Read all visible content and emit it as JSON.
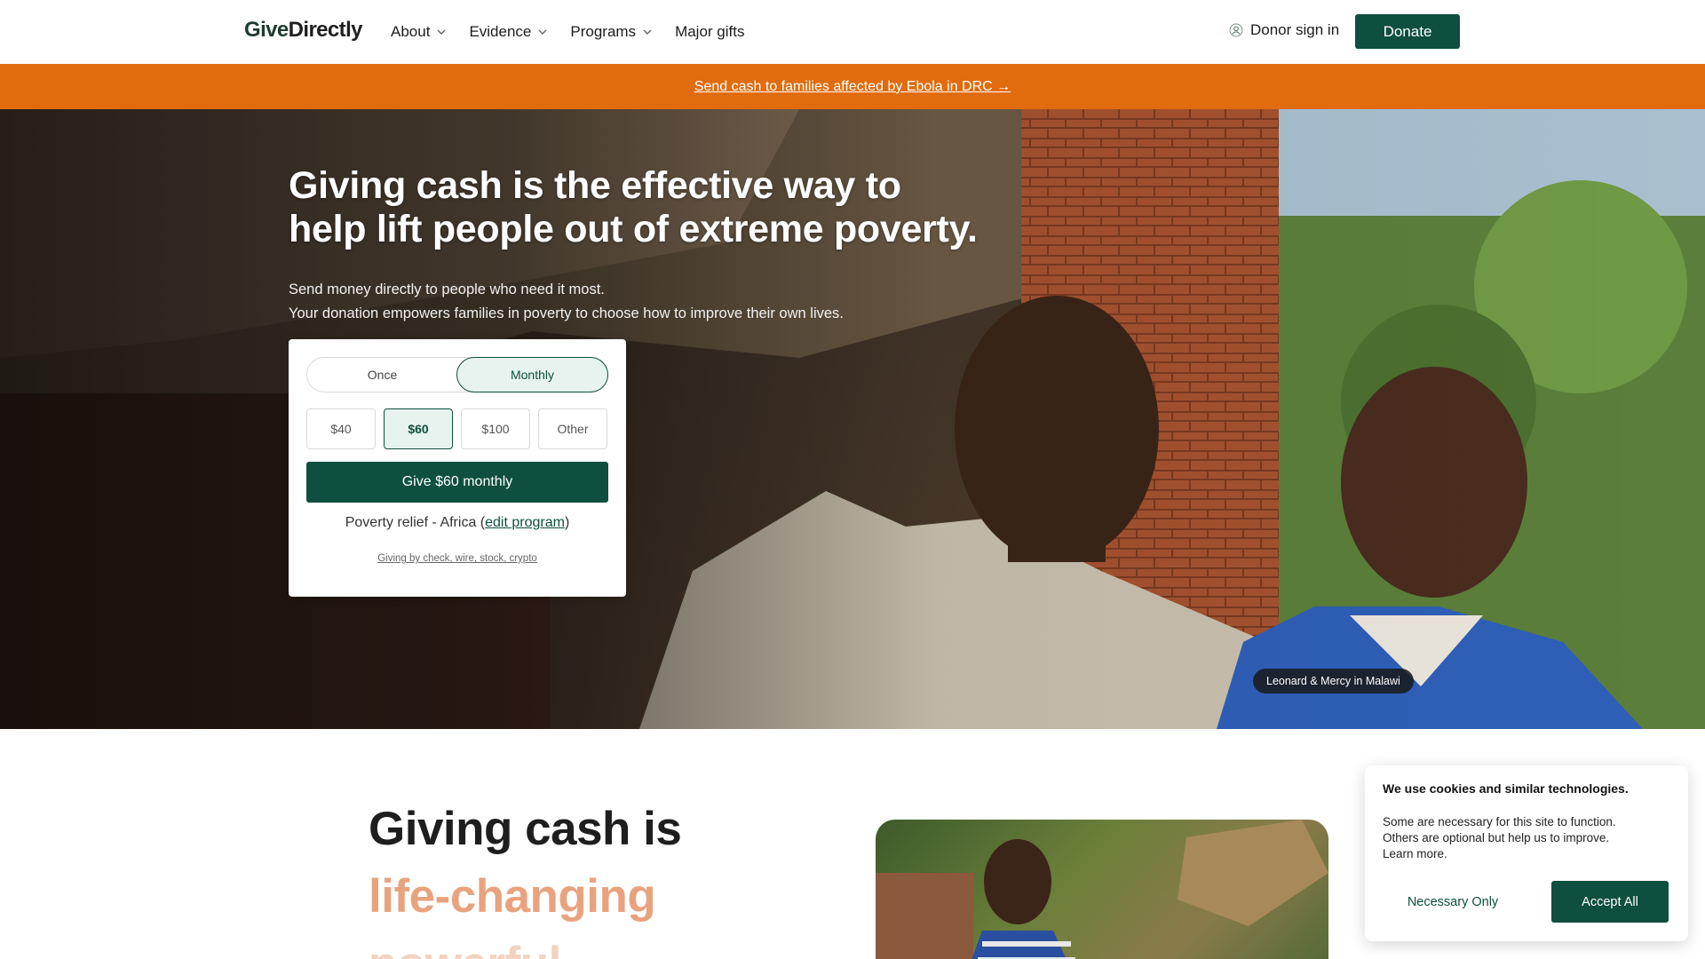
{
  "header": {
    "logo_part1": "Give",
    "logo_part2": "Directly",
    "nav": [
      {
        "label": "About",
        "has_dropdown": true,
        "icon": "chevron-down-icon"
      },
      {
        "label": "Evidence",
        "has_dropdown": true,
        "icon": "chevron-down-icon"
      },
      {
        "label": "Programs",
        "has_dropdown": true,
        "icon": "chevron-down-icon"
      },
      {
        "label": "Major gifts",
        "has_dropdown": false
      }
    ],
    "donor_sign_in": "Donor sign in",
    "donor_icon": "user-icon",
    "donate_label": "Donate"
  },
  "banner": {
    "text": "Send cash to families affected by Ebola in DRC →",
    "color": "#e06c0d"
  },
  "hero": {
    "title": "Giving cash is the effective way to help lift people out of extreme poverty.",
    "subtitle_line1": "Send money directly to people who need it most.",
    "subtitle_line2": "Your donation empowers families in poverty to choose how to improve their own lives.",
    "caption": "Leonard & Mercy in Malawi"
  },
  "donation_card": {
    "frequency_options": [
      "Once",
      "Monthly"
    ],
    "selected_frequency": "Monthly",
    "amounts": [
      "$40",
      "$60",
      "$100",
      "Other"
    ],
    "selected_amount": "$60",
    "give_button": "Give $60 monthly",
    "program_prefix": "Poverty relief - Africa (",
    "program_edit": "edit program",
    "program_suffix": ")",
    "other_ways": "Giving by check, wire, stock, crypto"
  },
  "lower": {
    "line1": "Giving cash is",
    "line2": "life-changing",
    "line3": "powerful"
  },
  "cookie": {
    "title": "We use cookies and similar technologies.",
    "body_line1": "Some are necessary for this site to function.",
    "body_line2": "Others are optional but help us to improve.",
    "learn_more": "Learn more.",
    "necessary_only": "Necessary Only",
    "accept_all": "Accept All"
  },
  "colors": {
    "brand_green": "#0e4f3f",
    "accent_orange": "#e06c0d",
    "highlight_peach": "#e8a37e"
  }
}
